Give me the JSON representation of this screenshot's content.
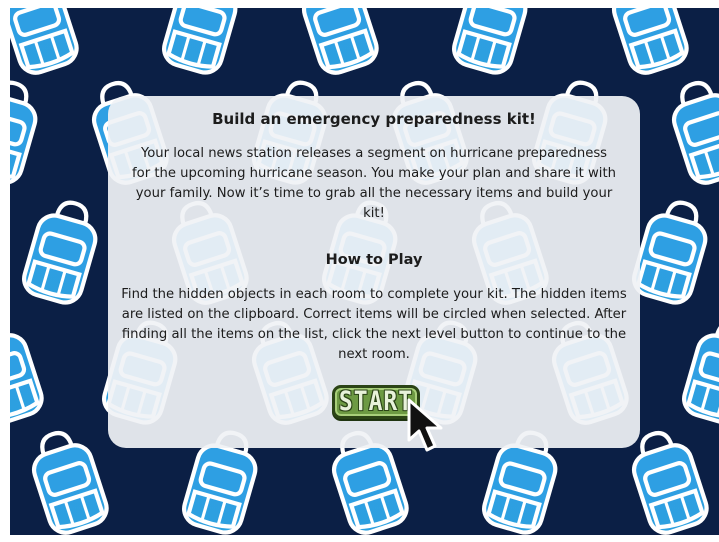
{
  "intro": {
    "title": "Build an emergency preparedness kit!",
    "body": "Your local news station releases a segment on hurricane preparedness for the upcoming hurricane season. You make your plan and share it with your family. Now it’s time to grab all the necessary items and build your kit!"
  },
  "how_to_play": {
    "title": "How to Play",
    "body": "Find the hidden objects in each room to complete your kit. The hidden items are listed on the clipboard. Correct items will be circled when selected. After finding all the items on the list, click the next level button to continue to the next room."
  },
  "start_button": {
    "label": "START"
  },
  "icons": {
    "background": "backpack-icon",
    "pointer": "cursor-arrow-icon"
  },
  "colors": {
    "background": "#0b1f45",
    "backpack_top": "#2e9fe3",
    "backpack_bottom": "#16a47c",
    "panel": "#f0f2f5",
    "button": "#6d9a43"
  }
}
